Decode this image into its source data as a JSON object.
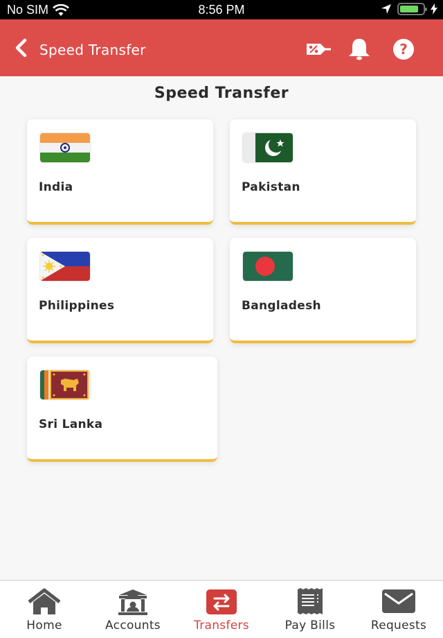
{
  "status_bar": {
    "carrier": "No SIM",
    "time": "8:56 PM",
    "battery_level": 0.8,
    "icons": [
      "wifi-icon",
      "location-arrow-icon",
      "battery-icon",
      "charging-bolt-icon"
    ]
  },
  "nav_bar": {
    "back_icon": "chevron-left-icon",
    "title": "Speed Transfer",
    "actions": [
      "discount-tag-icon",
      "bell-icon",
      "help-icon"
    ],
    "background": "#dd4e4b"
  },
  "main": {
    "title": "Speed Transfer",
    "countries": [
      {
        "name": "India",
        "flag": "india-flag"
      },
      {
        "name": "Pakistan",
        "flag": "pakistan-flag"
      },
      {
        "name": "Philippines",
        "flag": "philippines-flag"
      },
      {
        "name": "Bangladesh",
        "flag": "bangladesh-flag"
      },
      {
        "name": "Sri Lanka",
        "flag": "sri-lanka-flag"
      }
    ],
    "card_accent": "#f0bc40"
  },
  "tab_bar": {
    "active": "Transfers",
    "tabs": [
      {
        "label": "Home",
        "icon": "home-icon"
      },
      {
        "label": "Accounts",
        "icon": "bank-icon"
      },
      {
        "label": "Transfers",
        "icon": "transfer-arrows-icon"
      },
      {
        "label": "Pay Bills",
        "icon": "receipt-icon"
      },
      {
        "label": "Requests",
        "icon": "envelope-icon"
      }
    ],
    "active_color": "#d8403e"
  }
}
